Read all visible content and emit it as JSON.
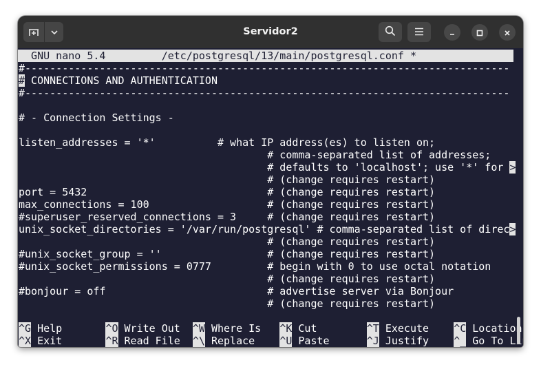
{
  "window": {
    "title": "Servidor2"
  },
  "icons": {
    "new_tab": "new-tab-icon",
    "dropdown": "chevron-down-icon",
    "search": "search-icon",
    "menu": "hamburger-menu-icon",
    "minimize": "minimize-icon",
    "maximize": "maximize-icon",
    "close": "close-icon"
  },
  "colors": {
    "terminal_bg": "#1e1f33",
    "terminal_fg": "#ffffff",
    "titlebar_bg": "#303030",
    "highlight_bg": "#e3e3e3"
  },
  "nano": {
    "header": "  GNU nano 5.4         /etc/postgresql/13/main/postgresql.conf *",
    "lines": [
      {
        "pre": "",
        "hl": "",
        "text": "#------------------------------------------------------------------------------"
      },
      {
        "pre": "",
        "hl": "#",
        "text": " CONNECTIONS AND AUTHENTICATION"
      },
      {
        "pre": "",
        "hl": "",
        "text": "#------------------------------------------------------------------------------"
      },
      {
        "pre": "",
        "hl": "",
        "text": ""
      },
      {
        "pre": "",
        "hl": "",
        "text": "# - Connection Settings -"
      },
      {
        "pre": "",
        "hl": "",
        "text": ""
      },
      {
        "pre": "",
        "hl": "",
        "text": "listen_addresses = '*'          # what IP address(es) to listen on;"
      },
      {
        "pre": "",
        "hl": "",
        "text": "                                        # comma-separated list of addresses;"
      },
      {
        "pre": "                                        # defaults to 'localhost'; use '*' for ",
        "hl": ">",
        "text": ""
      },
      {
        "pre": "",
        "hl": "",
        "text": "                                        # (change requires restart)"
      },
      {
        "pre": "",
        "hl": "",
        "text": "port = 5432                             # (change requires restart)"
      },
      {
        "pre": "",
        "hl": "",
        "text": "max_connections = 100                   # (change requires restart)"
      },
      {
        "pre": "",
        "hl": "",
        "text": "#superuser_reserved_connections = 3     # (change requires restart)"
      },
      {
        "pre": "unix_socket_directories = '/var/run/postgresql' # comma-separated list of direc",
        "hl": ">",
        "text": ""
      },
      {
        "pre": "",
        "hl": "",
        "text": "                                        # (change requires restart)"
      },
      {
        "pre": "",
        "hl": "",
        "text": "#unix_socket_group = ''                 # (change requires restart)"
      },
      {
        "pre": "",
        "hl": "",
        "text": "#unix_socket_permissions = 0777         # begin with 0 to use octal notation"
      },
      {
        "pre": "",
        "hl": "",
        "text": "                                        # (change requires restart)"
      },
      {
        "pre": "",
        "hl": "",
        "text": "#bonjour = off                          # advertise server via Bonjour"
      },
      {
        "pre": "",
        "hl": "",
        "text": "                                        # (change requires restart)"
      }
    ],
    "shortcuts_row1": [
      {
        "key": "^G",
        "label": " Help      "
      },
      {
        "key": "^O",
        "label": " Write Out "
      },
      {
        "key": "^W",
        "label": " Where Is  "
      },
      {
        "key": "^K",
        "label": " Cut       "
      },
      {
        "key": "^T",
        "label": " Execute   "
      },
      {
        "key": "^C",
        "label": " Location"
      }
    ],
    "shortcuts_row2": [
      {
        "key": "^X",
        "label": " Exit      "
      },
      {
        "key": "^R",
        "label": " Read File "
      },
      {
        "key": "^\\",
        "label": " Replace   "
      },
      {
        "key": "^U",
        "label": " Paste     "
      },
      {
        "key": "^J",
        "label": " Justify   "
      },
      {
        "key": "^_",
        "label": " Go To Line"
      }
    ]
  }
}
